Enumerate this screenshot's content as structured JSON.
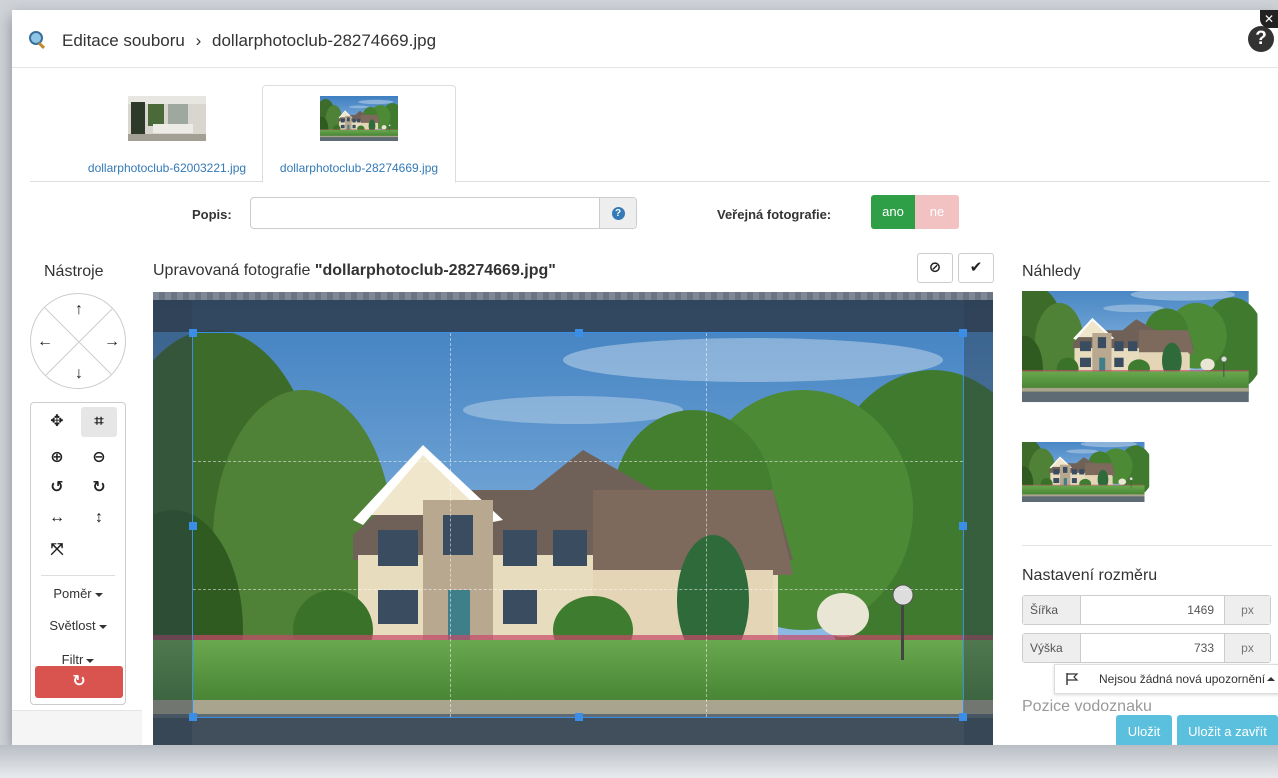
{
  "header": {
    "breadcrumb_root": "Editace souboru",
    "separator": "›",
    "file_name": "dollarphotoclub-28274669.jpg",
    "help_glyph": "?",
    "close_glyph": "✕",
    "icons": [
      "image-search-icon",
      "help-icon",
      "close-icon"
    ]
  },
  "tabs": [
    {
      "label": "dollarphotoclub-62003221.jpg",
      "active": false
    },
    {
      "label": "dollarphotoclub-28274669.jpg",
      "active": true
    }
  ],
  "form": {
    "description_label": "Popis:",
    "description_value": "",
    "description_info_glyph": "?",
    "public_label": "Veřejná fotografie:",
    "yes_label": "ano",
    "no_label": "ne"
  },
  "tools": {
    "title": "Nástroje",
    "arrows": {
      "up": "↑",
      "left": "←",
      "right": "→",
      "down": "↓"
    },
    "glyphs": {
      "move": "✥",
      "crop": "⌗",
      "zoom_in": "⊕",
      "zoom_out": "⊖",
      "rotate_left": "↺",
      "rotate_right": "↻",
      "flip_horizontal": "↔",
      "flip_vertical": "↕",
      "fullscreen": "⤧",
      "reset": "↻"
    },
    "ratio_label": "Poměr",
    "brightness_label": "Světlost",
    "filter_label": "Filtr"
  },
  "editor": {
    "title_prefix": "Upravovaná fotografie ",
    "title_file": "\"dollarphotoclub-28274669.jpg\"",
    "cancel_glyph": "⊘",
    "confirm_glyph": "✔"
  },
  "previews": {
    "title": "Náhledy"
  },
  "size": {
    "title": "Nastavení rozměru",
    "width_label": "Šířka",
    "width_value": "1469",
    "height_label": "Výška",
    "height_value": "733",
    "unit": "px"
  },
  "watermark": {
    "title": "Pozice vodoznaku"
  },
  "notification": {
    "text": "Nejsou žádná nová upozornění"
  },
  "actions": {
    "save_label": "Uložit",
    "save_close_label": "Uložit a zavřít"
  },
  "colors": {
    "accent_blue": "#337ab7",
    "success_green": "#2e9e47",
    "danger_red": "#d9534f",
    "info_cyan": "#5bc0de",
    "crop_blue": "#3a8ee6"
  }
}
